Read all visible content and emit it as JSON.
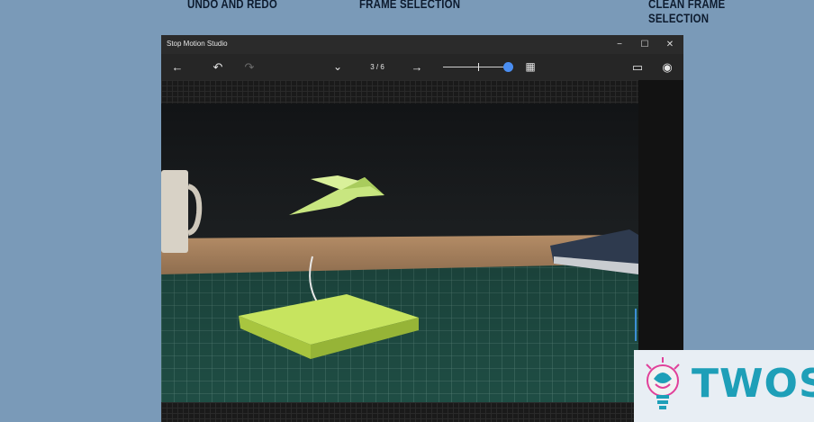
{
  "callouts": {
    "undo_redo": "UNDO AND REDO",
    "frame_selection": "FRAME SELECTION",
    "clean_frame_line1": "CLEAN FRAME",
    "clean_frame_line2": "SELECTION"
  },
  "window": {
    "title": "Stop Motion Studio",
    "controls": {
      "minimize": "−",
      "maximize": "☐",
      "close": "✕"
    }
  },
  "toolbar": {
    "back_icon": "←",
    "undo_icon": "↶",
    "redo_icon": "↷",
    "dropdown_icon": "⌄",
    "frame_counter": "3 / 6",
    "forward_icon": "→",
    "grid_icon": "▦",
    "aspect_icon": "▭",
    "play_icon": "◉",
    "zoom_level": 0.95
  },
  "accent_color": "#4a8ef2",
  "logo": {
    "text": "TWOS"
  }
}
